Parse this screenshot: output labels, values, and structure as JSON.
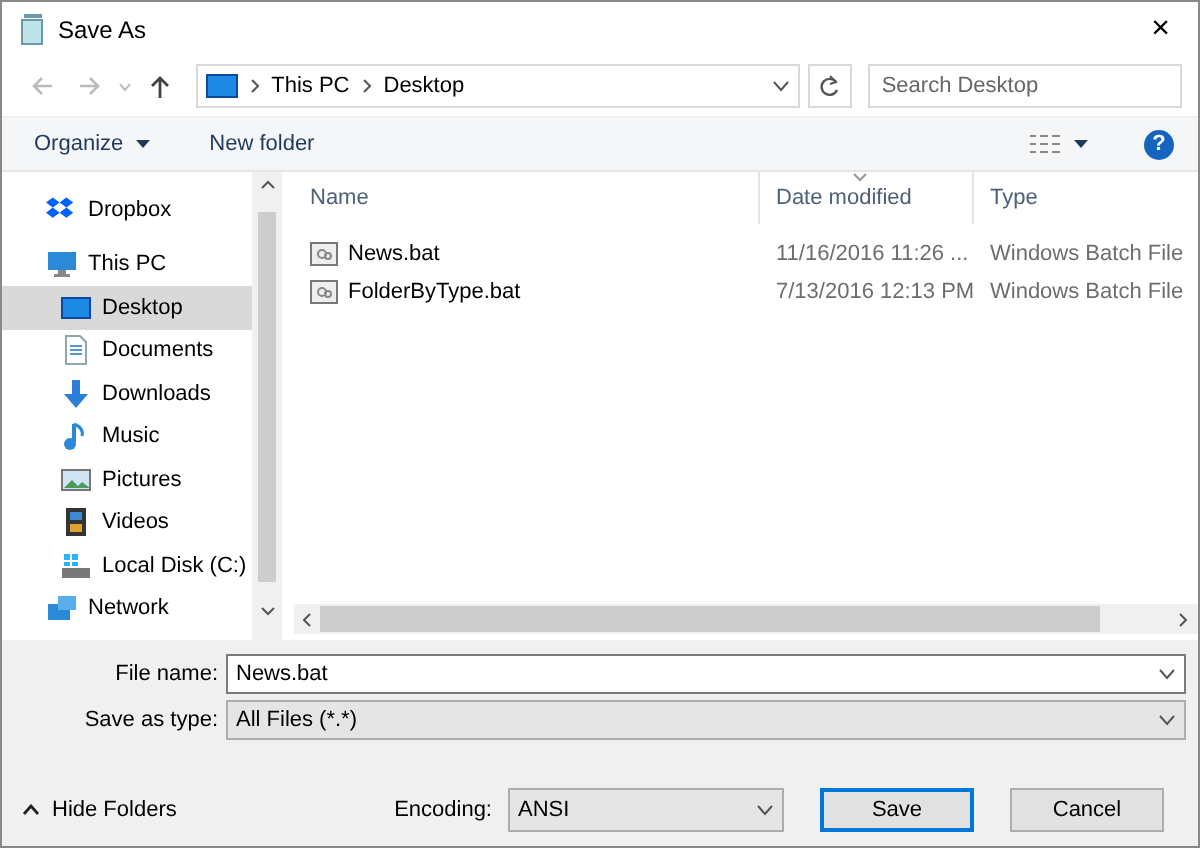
{
  "window": {
    "title": "Save As",
    "close": "×"
  },
  "address": {
    "crumbs": [
      "This PC",
      "Desktop"
    ]
  },
  "search": {
    "placeholder": "Search Desktop"
  },
  "toolbar": {
    "organize": "Organize",
    "new_folder": "New folder",
    "help": "?"
  },
  "sidebar": {
    "items": [
      {
        "label": "Dropbox",
        "kind": "dropbox",
        "selected": false
      },
      {
        "label": "This PC",
        "kind": "pc",
        "selected": false,
        "children": [
          {
            "label": "Desktop",
            "kind": "desktop",
            "selected": true
          },
          {
            "label": "Documents",
            "kind": "documents",
            "selected": false
          },
          {
            "label": "Downloads",
            "kind": "downloads",
            "selected": false
          },
          {
            "label": "Music",
            "kind": "music",
            "selected": false
          },
          {
            "label": "Pictures",
            "kind": "pictures",
            "selected": false
          },
          {
            "label": "Videos",
            "kind": "videos",
            "selected": false
          },
          {
            "label": "Local Disk (C:)",
            "kind": "disk",
            "selected": false
          }
        ]
      },
      {
        "label": "Network",
        "kind": "network",
        "selected": false
      }
    ]
  },
  "table": {
    "columns": [
      {
        "label": "Name",
        "sorted": false
      },
      {
        "label": "Date modified",
        "sorted": true
      },
      {
        "label": "Type",
        "sorted": false
      }
    ],
    "rows": [
      {
        "name": "News.bat",
        "date": "11/16/2016 11:26 ...",
        "type": "Windows Batch File"
      },
      {
        "name": "FolderByType.bat",
        "date": "7/13/2016 12:13 PM",
        "type": "Windows Batch File"
      }
    ]
  },
  "form": {
    "file_name_label": "File name:",
    "file_name": "News.bat",
    "type_label": "Save as type:",
    "type_value": "All Files  (*.*)"
  },
  "footer": {
    "hide_folders": "Hide Folders",
    "encoding_label": "Encoding:",
    "encoding": "ANSI",
    "save": "Save",
    "cancel": "Cancel"
  }
}
